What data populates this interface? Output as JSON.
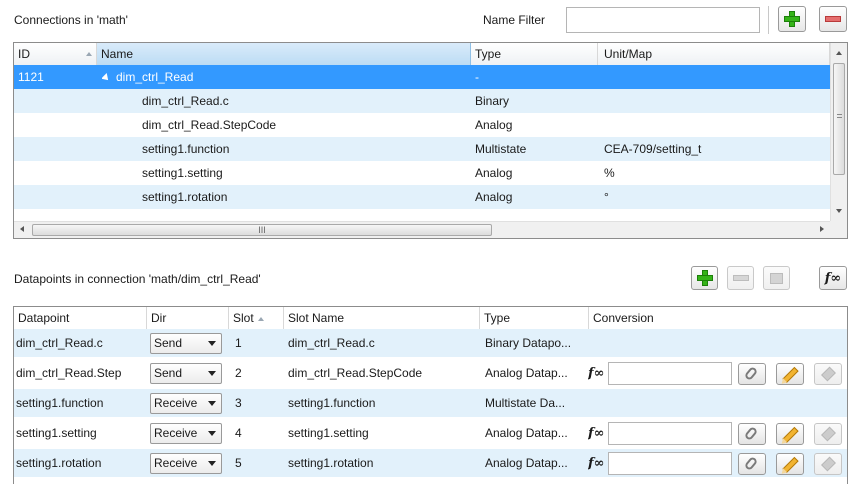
{
  "connections": {
    "title": "Connections in 'math'",
    "name_filter_label": "Name Filter",
    "name_filter_value": "",
    "columns": {
      "id": "ID",
      "name": "Name",
      "type": "Type",
      "unit": "Unit/Map"
    },
    "rows": [
      {
        "id": "1121",
        "name": "dim_ctrl_Read",
        "type": "-",
        "unit": "",
        "level": 0,
        "expanded": true,
        "selected": true
      },
      {
        "id": "",
        "name": "dim_ctrl_Read.c",
        "type": "Binary",
        "unit": "",
        "level": 1
      },
      {
        "id": "",
        "name": "dim_ctrl_Read.StepCode",
        "type": "Analog",
        "unit": "",
        "level": 1
      },
      {
        "id": "",
        "name": "setting1.function",
        "type": "Multistate",
        "unit": "CEA-709/setting_t",
        "level": 1
      },
      {
        "id": "",
        "name": "setting1.setting",
        "type": "Analog",
        "unit": "%",
        "level": 1
      },
      {
        "id": "",
        "name": "setting1.rotation",
        "type": "Analog",
        "unit": "°",
        "level": 1
      }
    ],
    "hscroll_label": "III"
  },
  "datapoints": {
    "title": "Datapoints in connection 'math/dim_ctrl_Read'",
    "columns": {
      "datapoint": "Datapoint",
      "dir": "Dir",
      "slot": "Slot",
      "slot_name": "Slot Name",
      "type": "Type",
      "conversion": "Conversion"
    },
    "fx_label": "f∞",
    "rows": [
      {
        "datapoint": "dim_ctrl_Read.c",
        "dir": "Send",
        "slot": "1",
        "slot_name": "dim_ctrl_Read.c",
        "type": "Binary Datapo...",
        "has_conversion": false
      },
      {
        "datapoint": "dim_ctrl_Read.Step",
        "dir": "Send",
        "slot": "2",
        "slot_name": "dim_ctrl_Read.StepCode",
        "type": "Analog Datap...",
        "has_conversion": true,
        "conversion": ""
      },
      {
        "datapoint": "setting1.function",
        "dir": "Receive",
        "slot": "3",
        "slot_name": "setting1.function",
        "type": "Multistate Da...",
        "has_conversion": false
      },
      {
        "datapoint": "setting1.setting",
        "dir": "Receive",
        "slot": "4",
        "slot_name": "setting1.setting",
        "type": "Analog Datap...",
        "has_conversion": true,
        "conversion": ""
      },
      {
        "datapoint": "setting1.rotation",
        "dir": "Receive",
        "slot": "5",
        "slot_name": "setting1.rotation",
        "type": "Analog Datap...",
        "has_conversion": true,
        "conversion": ""
      }
    ]
  },
  "colors": {
    "selection": "#3399ff",
    "row_alt": "#e2f1fb",
    "add_green": "#35b418",
    "remove_red": "#e56d6d"
  }
}
